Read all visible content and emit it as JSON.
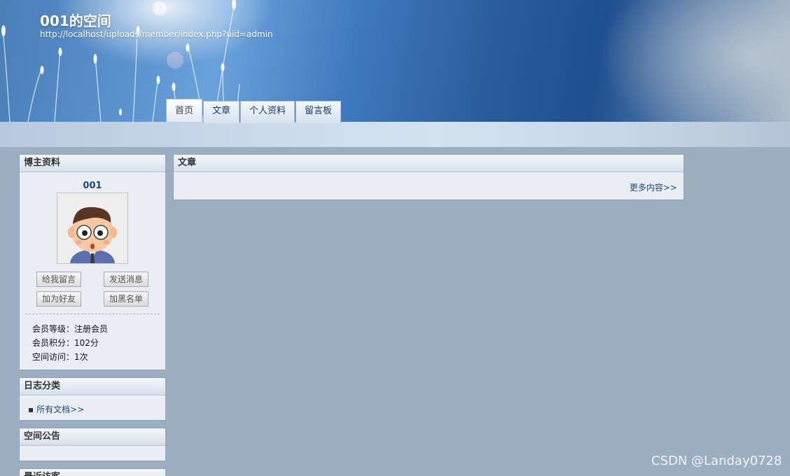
{
  "header": {
    "title": "001的空间",
    "url": "http://localhost/uploads/member/index.php?uid=admin"
  },
  "tabs": [
    {
      "label": "首页",
      "active": true
    },
    {
      "label": "文章",
      "active": false
    },
    {
      "label": "个人资料",
      "active": false
    },
    {
      "label": "留言板",
      "active": false
    }
  ],
  "profile": {
    "heading": "博主资料",
    "name": "001",
    "buttons": [
      "给我留言",
      "发送消息",
      "加为好友",
      "加黑名单"
    ],
    "stats": [
      {
        "label": "会员等级：",
        "value": "注册会员"
      },
      {
        "label": "会员积分：",
        "value": "102分"
      },
      {
        "label": "空间访问：",
        "value": "1次"
      }
    ]
  },
  "categories": {
    "heading": "日志分类",
    "all_link": "所有文档>>"
  },
  "notice": {
    "heading": "空间公告"
  },
  "recent": {
    "heading": "最近访客"
  },
  "articles": {
    "heading": "文章",
    "more_link": "更多内容>>"
  },
  "watermark": "CSDN @Landay0728",
  "colors": {
    "page_bg": "#9caec2",
    "panel_bg": "#eaeef4",
    "link": "#1b4883",
    "banner_blue": "#2a5c9c"
  }
}
